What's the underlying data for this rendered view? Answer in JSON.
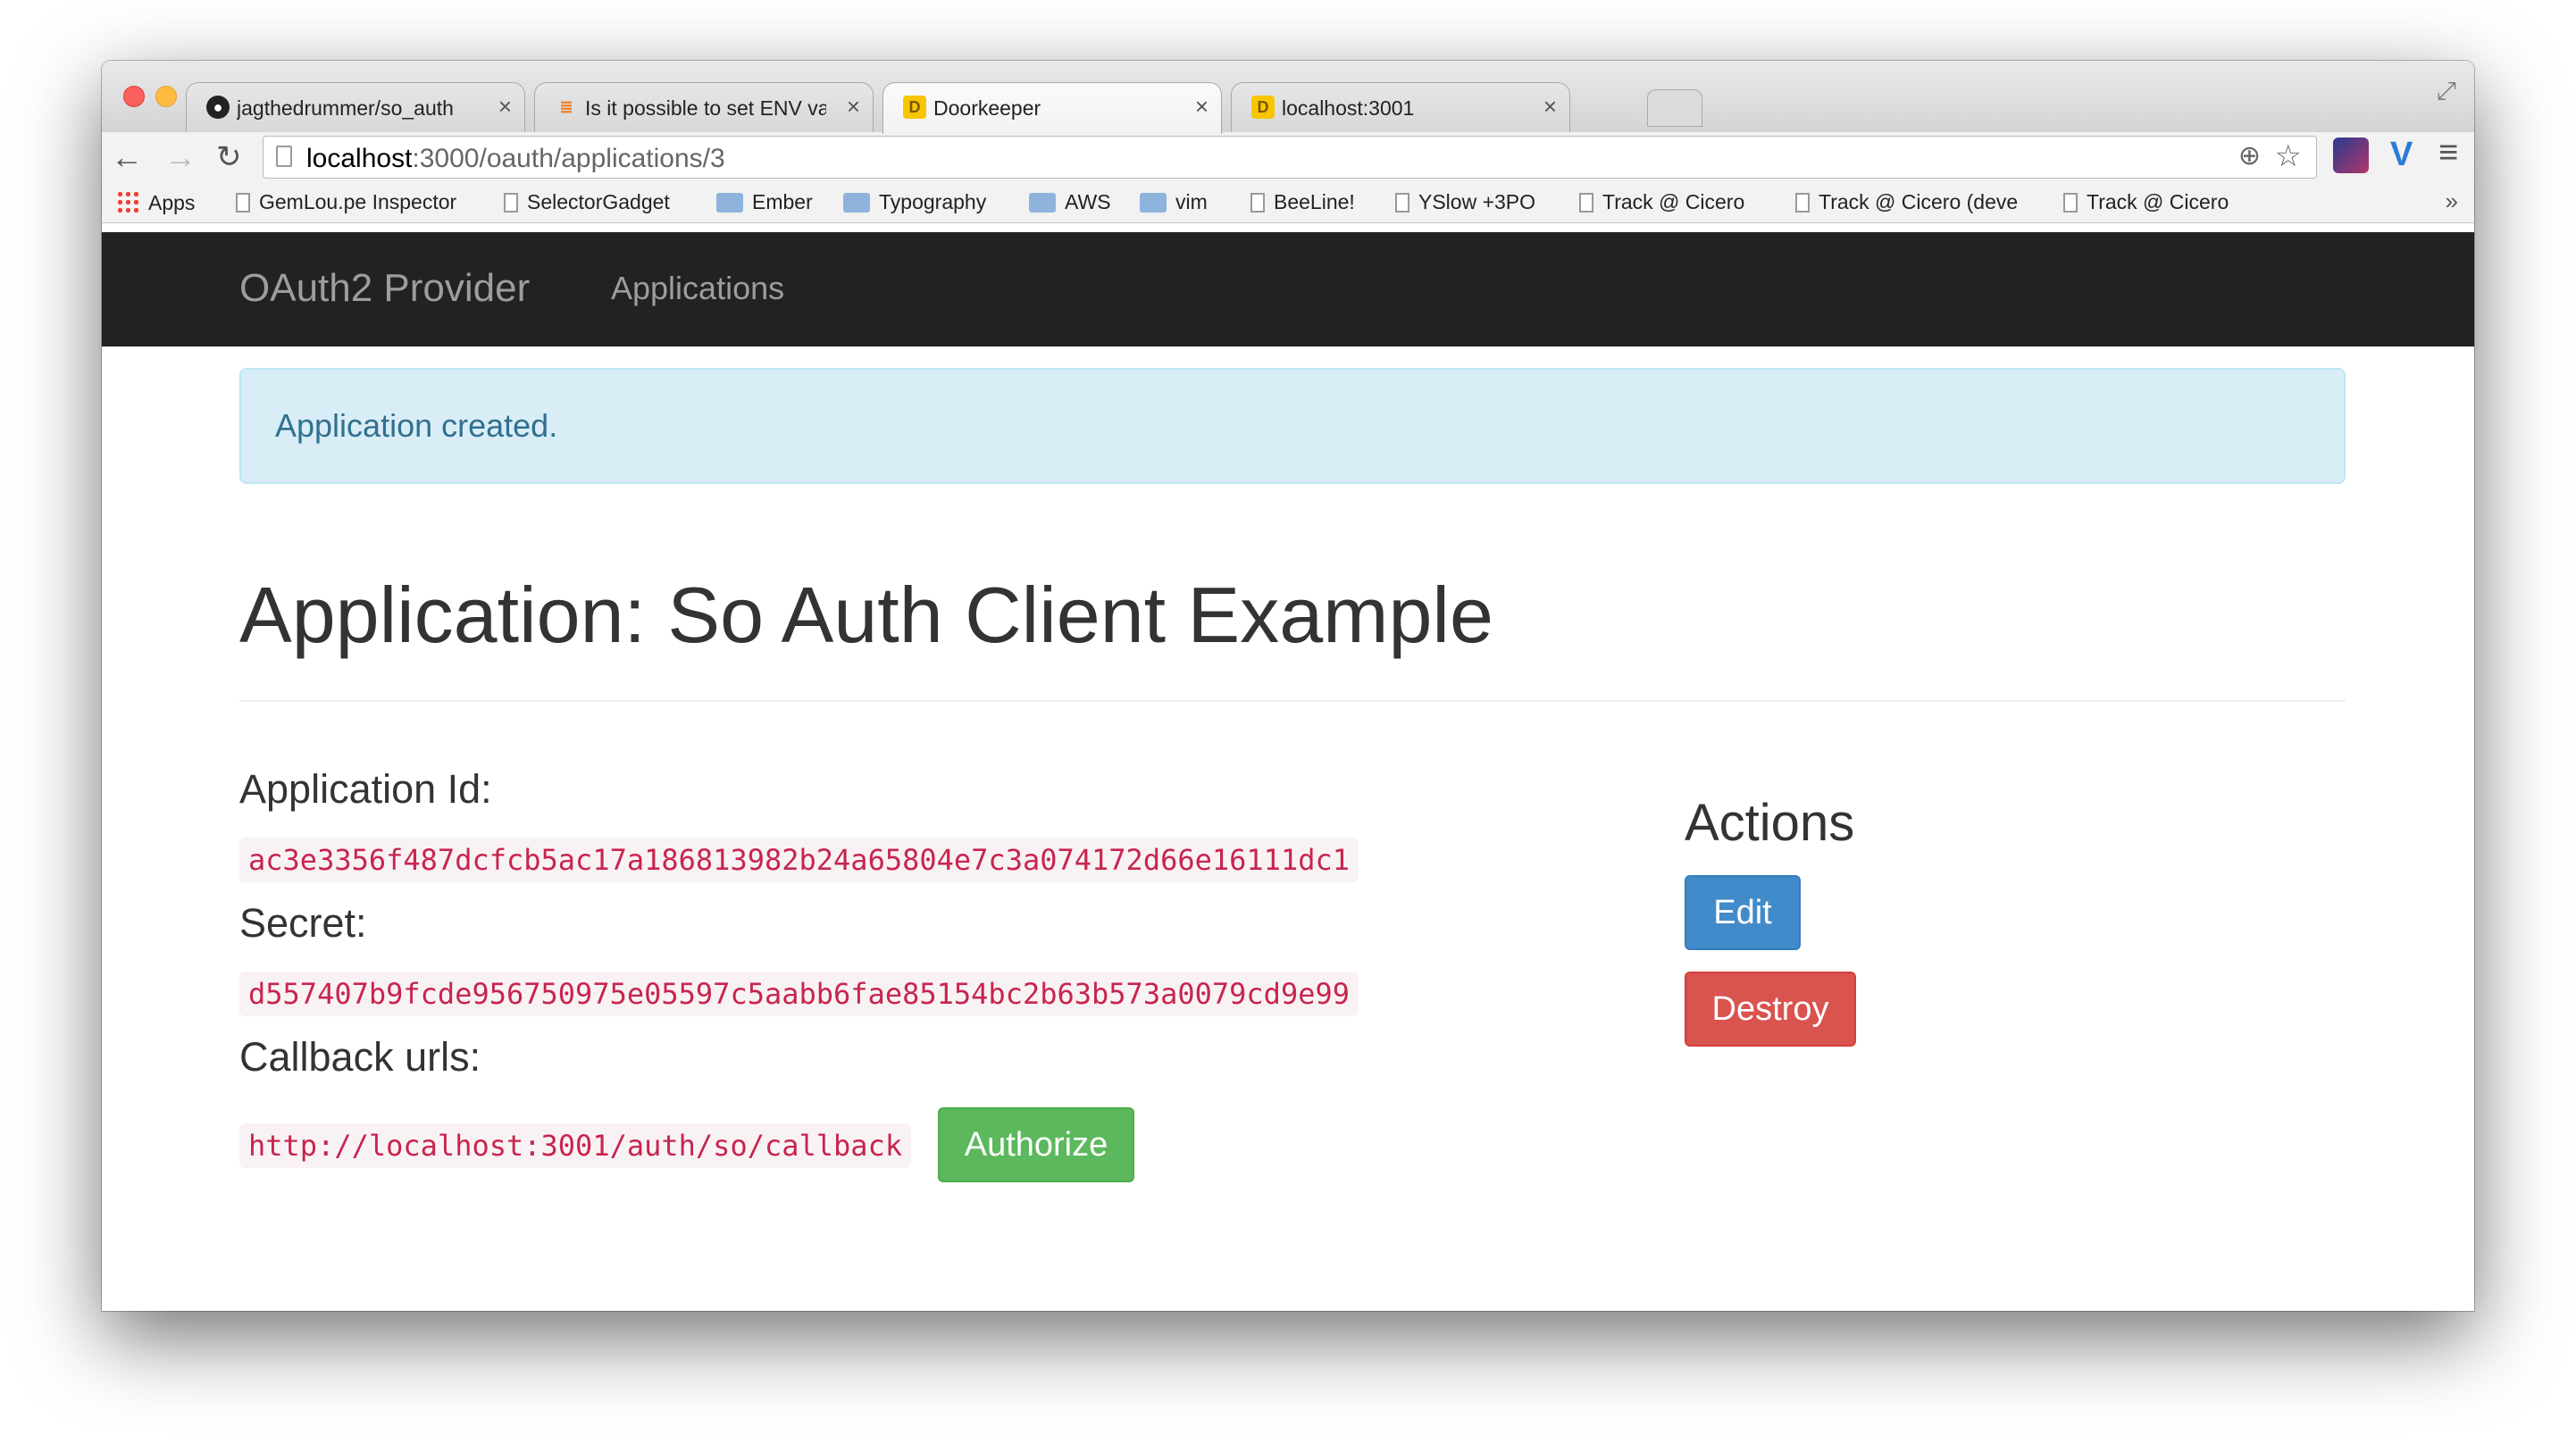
{
  "browser": {
    "tabs": [
      {
        "label": "jagthedrummer/so_auth",
        "icon": "github-icon",
        "active": false
      },
      {
        "label": "Is it possible to set ENV va",
        "icon": "stackoverflow-icon",
        "active": false
      },
      {
        "label": "Doorkeeper",
        "icon": "doorkeeper-icon",
        "active": true
      },
      {
        "label": "localhost:3001",
        "icon": "doorkeeper-icon",
        "active": false
      }
    ],
    "tab_close_glyph": "×",
    "url_host": "localhost",
    "url_rest": ":3000/oauth/applications/3",
    "bookmarks": [
      {
        "label": "Apps",
        "kind": "apps"
      },
      {
        "label": "GemLou.pe Inspector",
        "kind": "page"
      },
      {
        "label": "SelectorGadget",
        "kind": "page"
      },
      {
        "label": "Ember",
        "kind": "folder"
      },
      {
        "label": "Typography",
        "kind": "folder"
      },
      {
        "label": "AWS",
        "kind": "folder"
      },
      {
        "label": "vim",
        "kind": "folder"
      },
      {
        "label": "BeeLine!",
        "kind": "page"
      },
      {
        "label": "YSlow +3PO",
        "kind": "page"
      },
      {
        "label": "Track @ Cicero",
        "kind": "page"
      },
      {
        "label": "Track @ Cicero (deve",
        "kind": "page"
      },
      {
        "label": "Track @ Cicero",
        "kind": "page"
      }
    ],
    "bookmarks_more": "»"
  },
  "navbar": {
    "brand": "OAuth2 Provider",
    "links": [
      "Applications"
    ]
  },
  "alert": {
    "text": "Application created."
  },
  "page": {
    "title": "Application: So Auth Client Example",
    "application_id_label": "Application Id:",
    "application_id": "ac3e3356f487dcfcb5ac17a186813982b24a65804e7c3a074172d66e16111dc1",
    "secret_label": "Secret:",
    "secret": "d557407b9fcde956750975e05597c5aabb6fae85154bc2b63b573a0079cd9e99",
    "callback_label": "Callback urls:",
    "callback_url": "http://localhost:3001/auth/so/callback",
    "authorize_label": "Authorize",
    "actions_heading": "Actions",
    "edit_label": "Edit",
    "destroy_label": "Destroy"
  },
  "colors": {
    "navbar_bg": "#222222",
    "alert_bg": "#d9edf7",
    "alert_text": "#31708f",
    "code_text": "#c7254e",
    "btn_success": "#5cb85c",
    "btn_primary": "#428bca",
    "btn_danger": "#d9534f"
  }
}
